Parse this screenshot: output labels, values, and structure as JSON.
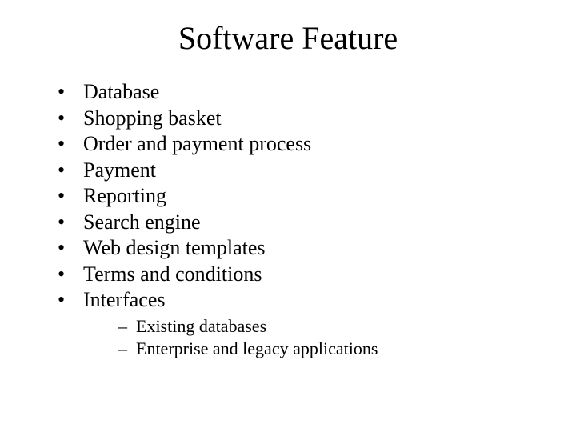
{
  "title": "Software Feature",
  "bullets": [
    "Database",
    "Shopping basket",
    "Order and payment process",
    "Payment",
    "Reporting",
    "Search engine",
    "Web design templates",
    "Terms and conditions",
    "Interfaces"
  ],
  "subbullets": [
    "Existing databases",
    "Enterprise and legacy applications"
  ]
}
